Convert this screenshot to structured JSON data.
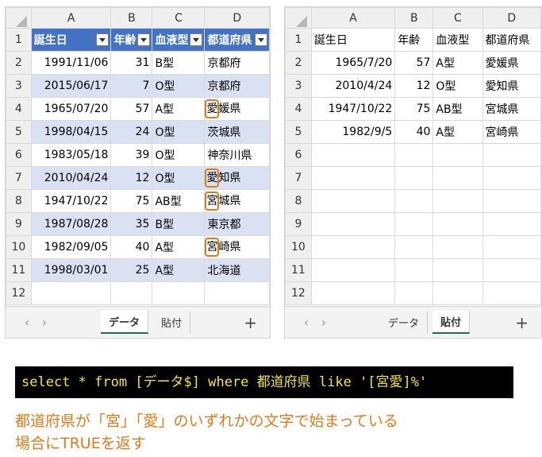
{
  "left_sheet": {
    "columns": [
      "A",
      "B",
      "C",
      "D"
    ],
    "headers": [
      "誕生日",
      "年齢",
      "血液型",
      "都道府県"
    ],
    "rows": [
      {
        "num": "2",
        "date": "1991/11/06",
        "age": "31",
        "blood": "B型",
        "pref": "京都府",
        "hl": ""
      },
      {
        "num": "3",
        "date": "2015/06/17",
        "age": "7",
        "blood": "O型",
        "pref": "京都府",
        "hl": ""
      },
      {
        "num": "4",
        "date": "1965/07/20",
        "age": "57",
        "blood": "A型",
        "pref_first": "愛",
        "pref_rest": "媛県",
        "hl": "1"
      },
      {
        "num": "5",
        "date": "1998/04/15",
        "age": "24",
        "blood": "O型",
        "pref": "茨城県",
        "hl": ""
      },
      {
        "num": "6",
        "date": "1983/05/18",
        "age": "39",
        "blood": "O型",
        "pref": "神奈川県",
        "hl": ""
      },
      {
        "num": "7",
        "date": "2010/04/24",
        "age": "12",
        "blood": "O型",
        "pref_first": "愛",
        "pref_rest": "知県",
        "hl": "1"
      },
      {
        "num": "8",
        "date": "1947/10/22",
        "age": "75",
        "blood": "AB型",
        "pref_first": "宮",
        "pref_rest": "城県",
        "hl": "1"
      },
      {
        "num": "9",
        "date": "1987/08/28",
        "age": "35",
        "blood": "B型",
        "pref": "東京都",
        "hl": ""
      },
      {
        "num": "10",
        "date": "1982/09/05",
        "age": "40",
        "blood": "A型",
        "pref_first": "宮",
        "pref_rest": "崎県",
        "hl": "1"
      },
      {
        "num": "11",
        "date": "1998/03/01",
        "age": "25",
        "blood": "A型",
        "pref": "北海道",
        "hl": ""
      }
    ],
    "empty_row": "12",
    "tabs": [
      "データ",
      "貼付"
    ],
    "add_tab": "+"
  },
  "right_sheet": {
    "columns": [
      "A",
      "B",
      "C",
      "D"
    ],
    "headers": [
      "誕生日",
      "年齢",
      "血液型",
      "都道府県"
    ],
    "rows": [
      {
        "num": "2",
        "date": "1965/7/20",
        "age": "57",
        "blood": "A型",
        "pref": "愛媛県"
      },
      {
        "num": "3",
        "date": "2010/4/24",
        "age": "12",
        "blood": "O型",
        "pref": "愛知県"
      },
      {
        "num": "4",
        "date": "1947/10/22",
        "age": "75",
        "blood": "AB型",
        "pref": "宮城県"
      },
      {
        "num": "5",
        "date": "1982/9/5",
        "age": "40",
        "blood": "A型",
        "pref": "宮崎県"
      }
    ],
    "empty_rows": [
      "6",
      "7",
      "8",
      "9",
      "10",
      "11",
      "12"
    ],
    "tabs": [
      "データ",
      "貼付"
    ],
    "add_tab": "+"
  },
  "sql": "select * from [データ$] where 都道府県 like '[宮愛]%'",
  "note_line1": "都道府県が「宮」「愛」のいずれかの文字で始まっている",
  "note_line2": "場合にTRUEを返す",
  "accent_color": "#e07b1a",
  "table_header_color": "#4472c4",
  "band_color": "#d9e1f2"
}
